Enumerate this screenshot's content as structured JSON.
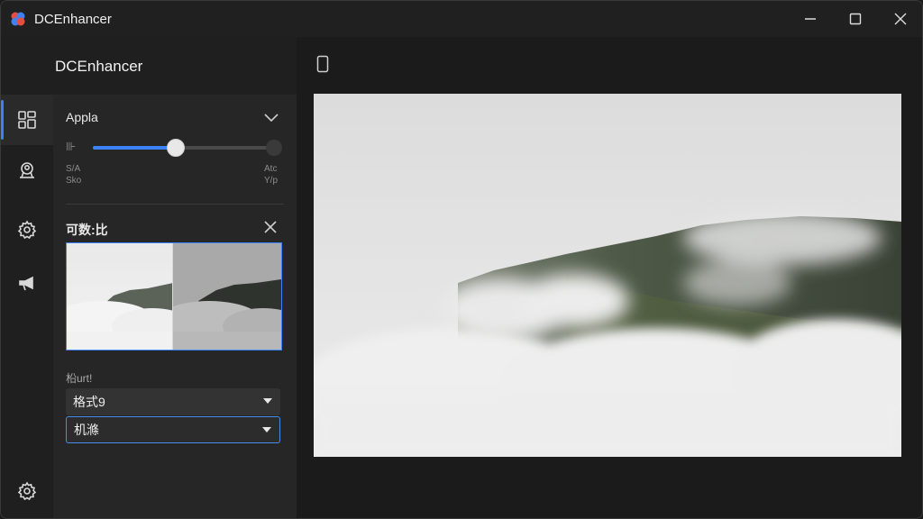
{
  "window": {
    "title": "DCEnhancer"
  },
  "header": {
    "app_name": "DCEnhancer"
  },
  "nav": {
    "items": [
      {
        "name": "layout-grid-icon",
        "active": true
      },
      {
        "name": "profile-icon",
        "active": false
      },
      {
        "name": "gear-icon",
        "active": false
      },
      {
        "name": "megaphone-icon",
        "active": false
      }
    ],
    "bottom": {
      "name": "settings-gear-icon"
    }
  },
  "panel": {
    "section_title": "Appla",
    "slider": {
      "icon_text": "⊪",
      "value": 0.46,
      "left_label_line1": "S/A",
      "left_label_line2": "Sko",
      "right_label_line1": "Atc",
      "right_label_line2": "Y/p"
    },
    "compare": {
      "title": "可数:比"
    },
    "format": {
      "label": "柗urt!",
      "select1_value": "格式9",
      "select2_value": "机滌"
    }
  },
  "colors": {
    "accent": "#3b82f6",
    "background": "#1e1e1e"
  }
}
